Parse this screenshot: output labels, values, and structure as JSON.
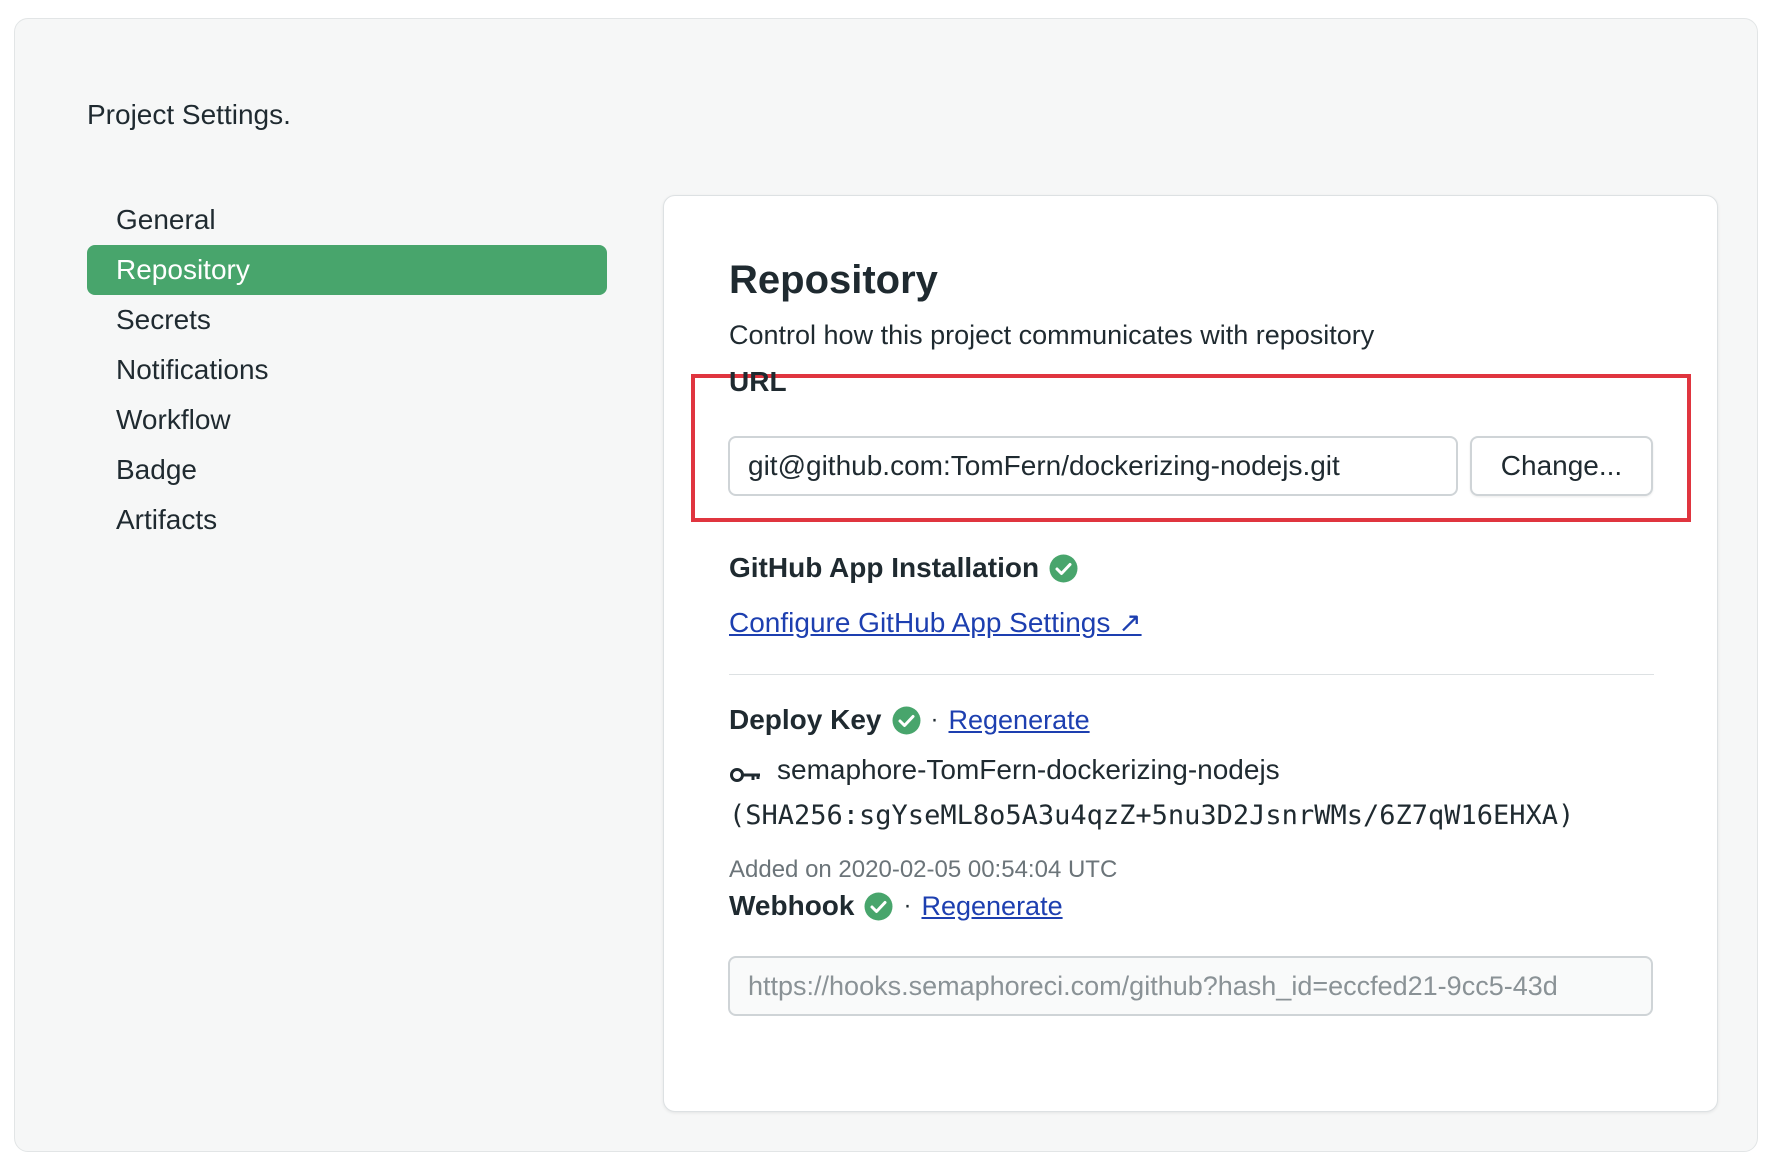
{
  "page": {
    "heading": "Project Settings."
  },
  "sidebar": {
    "items": [
      {
        "label": "General"
      },
      {
        "label": "Repository"
      },
      {
        "label": "Secrets"
      },
      {
        "label": "Notifications"
      },
      {
        "label": "Workflow"
      },
      {
        "label": "Badge"
      },
      {
        "label": "Artifacts"
      }
    ],
    "active": "Repository"
  },
  "repository": {
    "title": "Repository",
    "subtitle": "Control how this project communicates with repository",
    "url": {
      "label": "URL",
      "value": "git@github.com:TomFern/dockerizing-nodejs.git",
      "change_label": "Change..."
    },
    "github_app": {
      "label": "GitHub App Installation",
      "status_icon": "check-circle-icon",
      "link_label": "Configure GitHub App Settings ↗"
    },
    "deploy_key": {
      "label": "Deploy Key",
      "status_icon": "check-circle-icon",
      "separator": "·",
      "regenerate_label": "Regenerate",
      "key_icon": "key-icon",
      "key_name": "semaphore-TomFern-dockerizing-nodejs",
      "fingerprint": "(SHA256:sgYseML8o5A3u4qzZ+5nu3D2JsnrWMs/6Z7qW16EHXA)",
      "added_on": "Added on 2020-02-05 00:54:04 UTC"
    },
    "webhook": {
      "label": "Webhook",
      "status_icon": "check-circle-icon",
      "separator": "·",
      "regenerate_label": "Regenerate",
      "value": "https://hooks.semaphoreci.com/github?hash_id=eccfed21-9cc5-43d"
    }
  },
  "colors": {
    "accent_green": "#48a56c",
    "highlight_red": "#e0353f",
    "link_blue": "#1d3fb0"
  }
}
